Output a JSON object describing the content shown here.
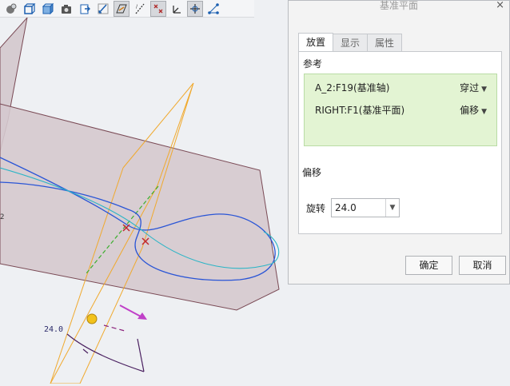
{
  "toolbar": {
    "icons": [
      "shading-icon",
      "box-view-icon",
      "cube-view-icon",
      "camera-icon",
      "export-icon",
      "sketch-pencil-icon",
      "datum-plane-display-icon",
      "datum-axis-display-icon",
      "datum-point-display-icon",
      "csys-display-icon",
      "spin-center-icon",
      "annotation-display-icon"
    ]
  },
  "viewport": {
    "dimension_label": "24.0",
    "side_label": "2"
  },
  "dialog": {
    "title": "基准平面",
    "close_symbol": "×",
    "tabs": [
      {
        "label": "放置",
        "active": true
      },
      {
        "label": "显示",
        "active": false
      },
      {
        "label": "属性",
        "active": false
      }
    ],
    "placement": {
      "references_label": "参考",
      "references": [
        {
          "name": "A_2:F19(基准轴)",
          "constraint": "穿过"
        },
        {
          "name": "RIGHT:F1(基准平面)",
          "constraint": "偏移"
        }
      ],
      "offset_label": "偏移",
      "rotation_label": "旋转",
      "rotation_value": "24.0"
    },
    "buttons": {
      "ok": "确定",
      "cancel": "取消"
    }
  },
  "colors": {
    "reference_list_bg": "#e3f4d3",
    "datum_plane_edge": "#f0a92d",
    "curve_blue": "#2a55d6",
    "curve_cyan": "#2bb5c6",
    "surface_fill": "#d8cbd0",
    "drag_arrow": "#c040c8",
    "axis_green": "#3cae2e"
  }
}
